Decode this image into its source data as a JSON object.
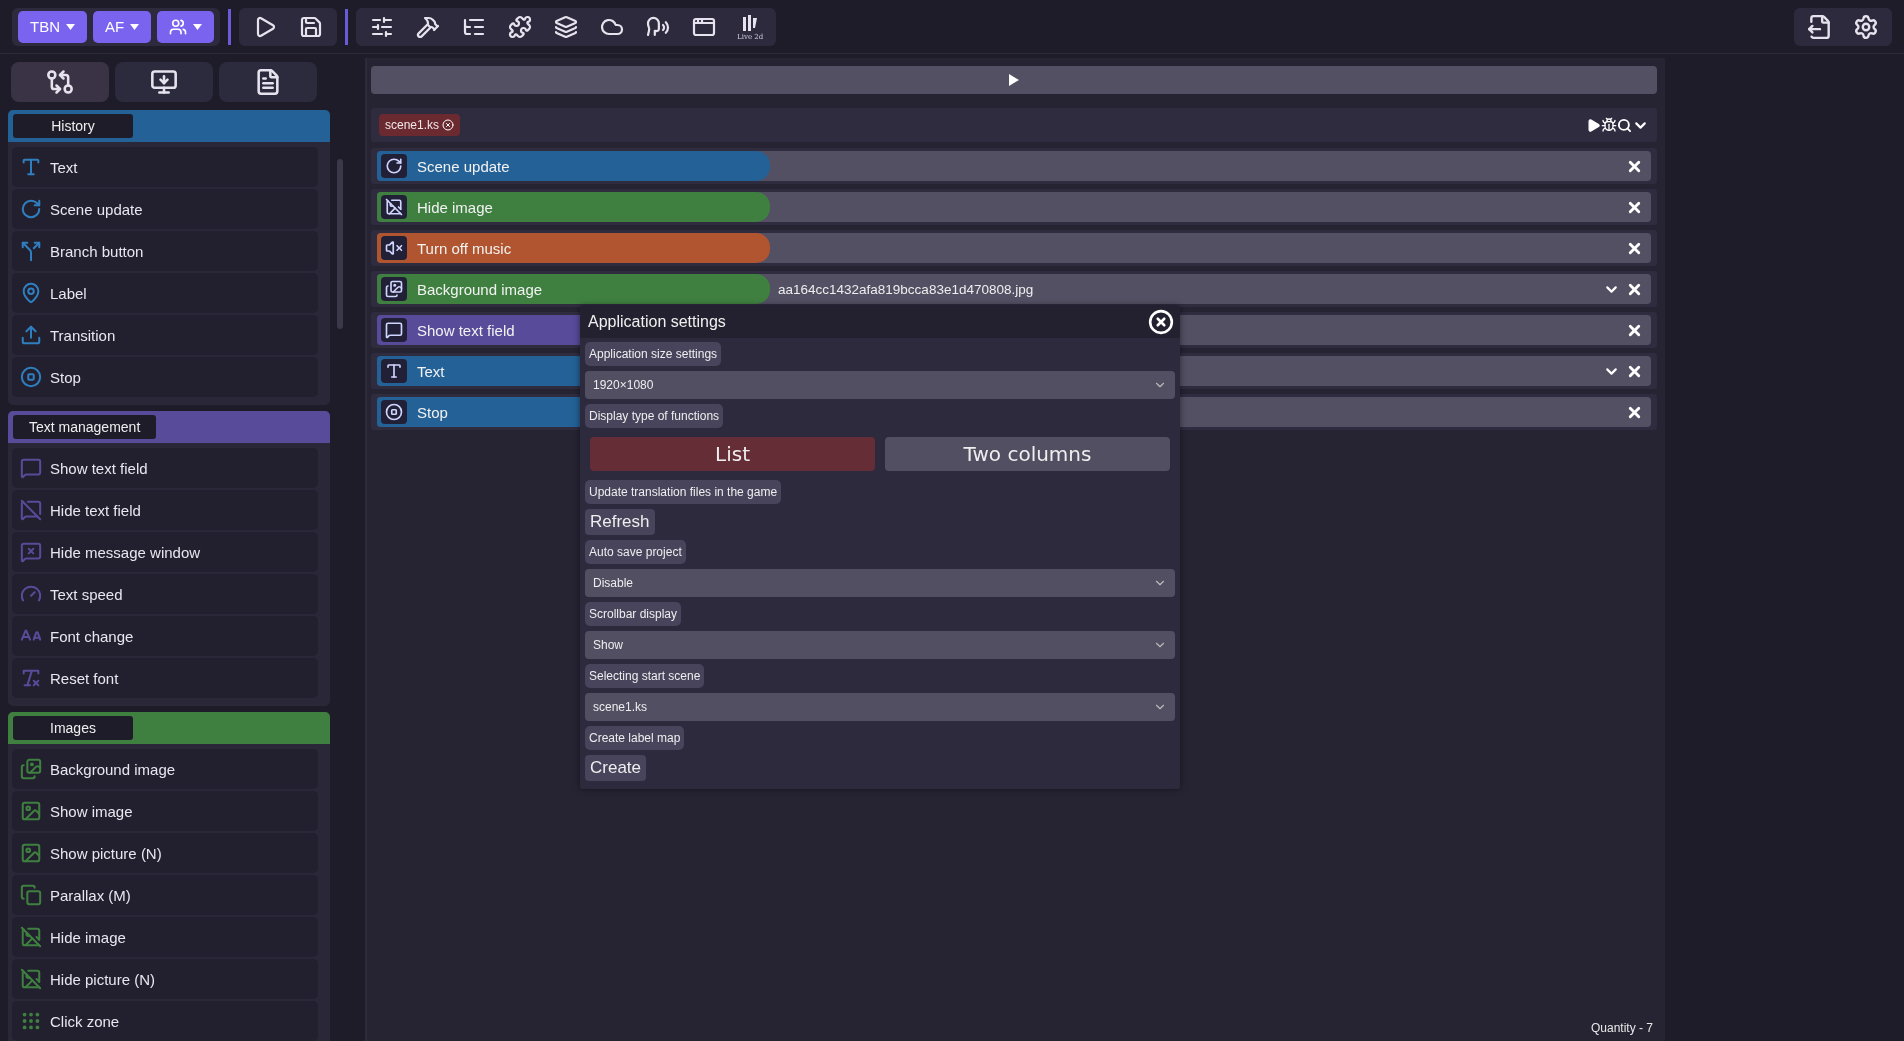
{
  "toolbar": {
    "dropdowns": [
      {
        "kind": "text",
        "label": "TBN"
      },
      {
        "kind": "text",
        "label": "AF"
      },
      {
        "kind": "users"
      }
    ],
    "icons": [
      {
        "kind": "play"
      },
      {
        "kind": "save"
      },
      {
        "kind": "sliders"
      },
      {
        "kind": "hammer"
      },
      {
        "kind": "tree"
      },
      {
        "kind": "puzzle"
      },
      {
        "kind": "layers"
      },
      {
        "kind": "cloud"
      },
      {
        "kind": "voice"
      },
      {
        "kind": "window"
      },
      {
        "kind": "live2d"
      }
    ],
    "live2d_label": "Live 2d",
    "right_icons": [
      {
        "kind": "export"
      },
      {
        "kind": "settings"
      }
    ]
  },
  "sidebar": {
    "tabs": [
      {
        "kind": "flow",
        "selected": true
      },
      {
        "kind": "download",
        "selected": false
      },
      {
        "kind": "file",
        "selected": false
      }
    ],
    "sections": [
      {
        "title": "History",
        "color": "#236196",
        "items": [
          {
            "kind": "text",
            "label": "Text"
          },
          {
            "kind": "refresh",
            "label": "Scene update"
          },
          {
            "kind": "branch",
            "label": "Branch button"
          },
          {
            "kind": "pin",
            "label": "Label"
          },
          {
            "kind": "upload",
            "label": "Transition"
          },
          {
            "kind": "stop",
            "label": "Stop"
          }
        ]
      },
      {
        "title": "Text management",
        "color": "#574b9a",
        "items": [
          {
            "kind": "msg",
            "label": "Show text field"
          },
          {
            "kind": "msgoff",
            "label": "Hide text field"
          },
          {
            "kind": "msgx",
            "label": "Hide message window"
          },
          {
            "kind": "gauge",
            "label": "Text speed"
          },
          {
            "kind": "font",
            "label": "Font change"
          },
          {
            "kind": "reset",
            "label": "Reset font"
          }
        ]
      },
      {
        "title": "Images",
        "color": "#3f8040",
        "items": [
          {
            "kind": "images",
            "label": "Background image"
          },
          {
            "kind": "image",
            "label": "Show image"
          },
          {
            "kind": "image",
            "label": "Show picture (N)"
          },
          {
            "kind": "copy",
            "label": "Parallax (M)"
          },
          {
            "kind": "imageoff",
            "label": "Hide image"
          },
          {
            "kind": "imageoff",
            "label": "Hide picture (N)"
          },
          {
            "kind": "grip",
            "label": "Click zone"
          }
        ]
      }
    ]
  },
  "editor": {
    "file_tab": "scene1.ks",
    "rows": [
      {
        "kind": "refresh",
        "label": "Scene update",
        "color": "#236196",
        "expandable": false
      },
      {
        "kind": "imageoff",
        "label": "Hide image",
        "color": "#3f8040",
        "expandable": false
      },
      {
        "kind": "mute",
        "label": "Turn off music",
        "color": "#b0552f",
        "expandable": false
      },
      {
        "kind": "images",
        "label": "Background image",
        "color": "#3f8040",
        "value": "aa164cc1432afa819bcca83e1d470808.jpg",
        "expandable": true
      },
      {
        "kind": "msg",
        "label": "Show text field",
        "color": "#574b9a",
        "expandable": false
      },
      {
        "kind": "text",
        "label": "Text",
        "color": "#236196",
        "expandable": true
      },
      {
        "kind": "stop",
        "label": "Stop",
        "color": "#236196",
        "expandable": false
      }
    ],
    "quantity": "Quantity - 7"
  },
  "dialog": {
    "title": "Application settings",
    "sections": [
      {
        "label": "Application size settings",
        "kind": "select",
        "value": "1920×1080"
      },
      {
        "label": "Display type of functions",
        "kind": "toggle",
        "options": [
          {
            "label": "List",
            "selected": true
          },
          {
            "label": "Two columns",
            "selected": false
          }
        ]
      },
      {
        "label": "Update translation files in the game",
        "kind": "button",
        "button": "Refresh"
      },
      {
        "label": "Auto save project",
        "kind": "select",
        "value": "Disable"
      },
      {
        "label": "Scrollbar display",
        "kind": "select",
        "value": "Show"
      },
      {
        "label": "Selecting start scene",
        "kind": "select",
        "value": "scene1.ks"
      },
      {
        "label": "Create label map",
        "kind": "button",
        "button": "Create"
      }
    ]
  }
}
